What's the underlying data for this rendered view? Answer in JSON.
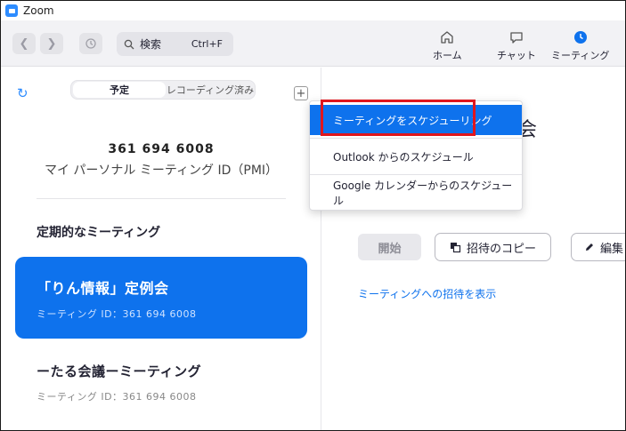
{
  "window": {
    "title": "Zoom"
  },
  "toolbar": {
    "back_icon": "chevron-left-icon",
    "forward_icon": "chevron-right-icon",
    "search_label": "検索",
    "search_shortcut": "Ctrl+F",
    "tabs": [
      {
        "label": "ホーム",
        "icon": "home-icon"
      },
      {
        "label": "チャット",
        "icon": "chat-icon"
      },
      {
        "label": "ミーティング",
        "icon": "clock-icon",
        "active": true
      }
    ]
  },
  "left_panel": {
    "segment": {
      "active": "予定",
      "inactive": "レコーディング済み"
    },
    "pmi_number": "361 694 6008",
    "pmi_label": "マイ パーソナル ミーティング ID（PMI）",
    "section_title": "定期的なミーティング",
    "meetings": [
      {
        "title": "「りん情報」定例会",
        "subtitle": "ミーティング ID：361 694 6008",
        "selected": true
      },
      {
        "title": "ーたる会議ーミーティング",
        "subtitle": "ミーティング ID：361 694 6008",
        "selected": false
      }
    ]
  },
  "right_panel": {
    "title_partial": "会",
    "start_label": "開始",
    "copy_invite_label": "招待のコピー",
    "edit_label": "編集",
    "show_invite_label": "ミーティングへの招待を表示"
  },
  "menu": {
    "items": [
      {
        "label": "ミーティングをスケジューリング",
        "selected": true
      },
      {
        "label": "Outlook からのスケジュール",
        "selected": false
      },
      {
        "label": "Google カレンダーからのスケジュール",
        "selected": false
      }
    ]
  },
  "colors": {
    "accent": "#0e72ed",
    "highlight": "#e0161d"
  }
}
